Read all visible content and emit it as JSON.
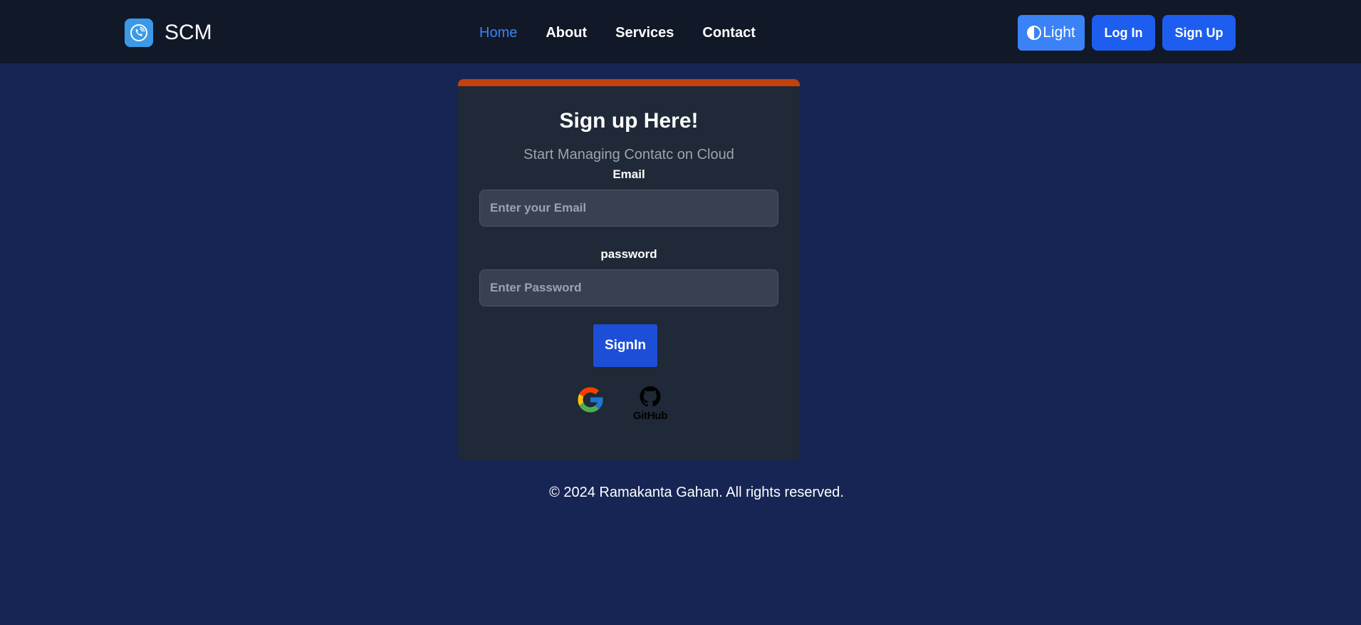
{
  "header": {
    "brand_name": "SCM",
    "logo_icon": "phone-call-icon",
    "nav": [
      {
        "label": "Home",
        "active": true
      },
      {
        "label": "About",
        "active": false
      },
      {
        "label": "Services",
        "active": false
      },
      {
        "label": "Contact",
        "active": false
      }
    ],
    "theme_label": "Light",
    "theme_icon": "half-circle-contrast-icon",
    "login_label": "Log In",
    "signup_label": "Sign Up"
  },
  "form": {
    "title": "Sign up Here!",
    "subtitle": "Start Managing Contatc on Cloud",
    "email_label": "Email",
    "email_placeholder": "Enter your Email",
    "email_value": "",
    "password_label": "password",
    "password_placeholder": "Enter Password",
    "password_value": "",
    "submit_label": "SignIn",
    "social": {
      "google_icon": "google-icon",
      "github_icon": "github-icon",
      "github_label": "GitHub"
    }
  },
  "footer": {
    "text": "© 2024 Ramakanta Gahan. All rights reserved."
  },
  "colors": {
    "page_bg": "#172554",
    "nav_bg": "#111827",
    "card_bg": "#1f2937",
    "card_accent": "#c2410c",
    "primary": "#1d5ef0",
    "active_link": "#3b82f6"
  }
}
